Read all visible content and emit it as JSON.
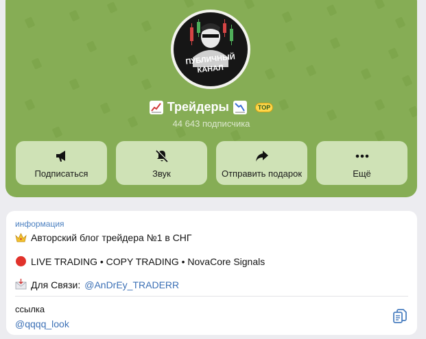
{
  "channel": {
    "name": "Трейдеры",
    "avatar_text_line1": "ПУБЛИЧНЫЙ",
    "avatar_text_line2": "КАНАЛ",
    "badge": "TOP",
    "subscribers": "44 643 подписчика"
  },
  "actions": [
    {
      "label": "Подписаться",
      "icon": "megaphone-icon"
    },
    {
      "label": "Звук",
      "icon": "bell-muted-icon"
    },
    {
      "label": "Отправить подарок",
      "icon": "share-arrow-icon"
    },
    {
      "label": "Ещё",
      "icon": "more-dots-icon"
    }
  ],
  "info": {
    "section_title": "информация",
    "line1": "Авторский блог трейдера №1 в СНГ",
    "line2": "LIVE TRADING • COPY TRADING • NovaCore Signals",
    "line3_prefix": "Для Связи:",
    "line3_mention": "@AnDrEy_TRADERR",
    "link_title": "ссылка",
    "link_value": "@qqqq_look"
  },
  "colors": {
    "header_bg": "#86ad55",
    "link": "#3a6fb5",
    "section_title": "#4a7fc0"
  }
}
